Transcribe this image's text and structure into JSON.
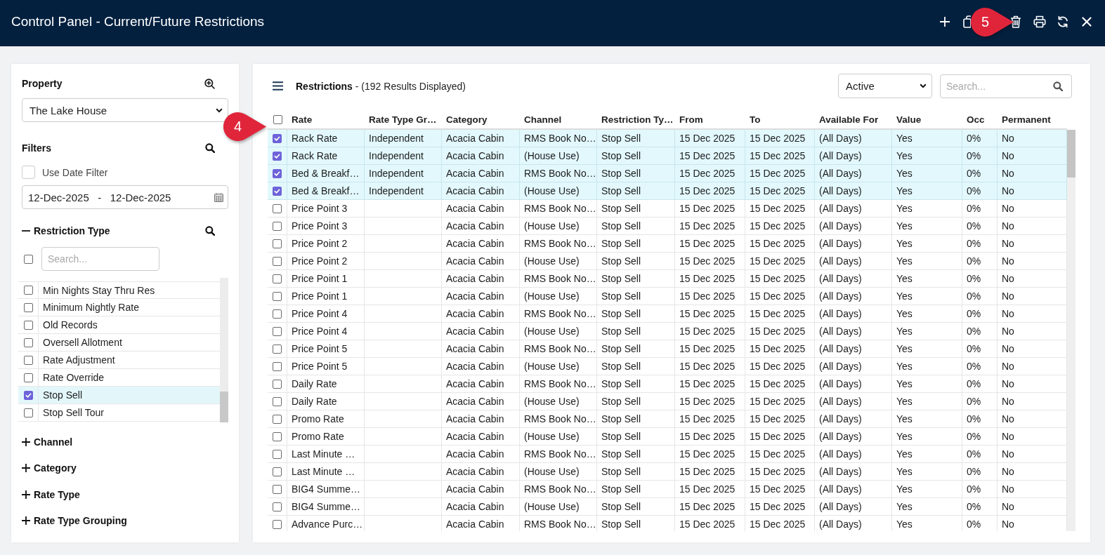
{
  "window": {
    "title": "Control Panel - Current/Future Restrictions"
  },
  "annotations": [
    {
      "number": "5"
    },
    {
      "number": "4"
    }
  ],
  "sidebar": {
    "property": {
      "label": "Property",
      "value": "The Lake House"
    },
    "filters": {
      "label": "Filters",
      "use_date_filter": {
        "label": "Use Date Filter",
        "checked": false
      },
      "date_range": "12-Dec-2025   -   12-Dec-2025"
    },
    "sections": [
      {
        "label": "Restriction Type",
        "expanded": true,
        "select_all_checked": false,
        "search": {
          "placeholder": "Search..."
        },
        "items": [
          {
            "label": "Min Nights Stay Thru Res",
            "checked": false
          },
          {
            "label": "Minimum Nightly Rate",
            "checked": false
          },
          {
            "label": "Old Records",
            "checked": false
          },
          {
            "label": "Oversell Allotment",
            "checked": false
          },
          {
            "label": "Rate Adjustment",
            "checked": false
          },
          {
            "label": "Rate Override",
            "checked": false
          },
          {
            "label": "Stop Sell",
            "checked": true
          },
          {
            "label": "Stop Sell Tour",
            "checked": false
          }
        ]
      },
      {
        "label": "Channel",
        "expanded": false
      },
      {
        "label": "Category",
        "expanded": false
      },
      {
        "label": "Rate Type",
        "expanded": false
      },
      {
        "label": "Rate Type Grouping",
        "expanded": false
      }
    ]
  },
  "results": {
    "heading": "**Restrictions** - (192 Results Displayed)",
    "status_filter": {
      "value": "Active"
    },
    "search": {
      "placeholder": "Search..."
    },
    "table": {
      "select_all_checked": false,
      "columns": [
        "Rate",
        "Rate Type Gr…",
        "Category",
        "Channel",
        "Restriction Ty…",
        "From",
        "To",
        "Available For",
        "Value",
        "Occ",
        "Permanent"
      ],
      "rows": [
        {
          "selected": true,
          "cells": [
            "Rack Rate",
            "Independent",
            "Acacia Cabin",
            "RMS Book No…",
            "Stop Sell",
            "15 Dec 2025",
            "15 Dec 2025",
            "(All Days)",
            "Yes",
            "0%",
            "No"
          ]
        },
        {
          "selected": true,
          "cells": [
            "Rack Rate",
            "Independent",
            "Acacia Cabin",
            "(House Use)",
            "Stop Sell",
            "15 Dec 2025",
            "15 Dec 2025",
            "(All Days)",
            "Yes",
            "0%",
            "No"
          ]
        },
        {
          "selected": true,
          "cells": [
            "Bed & Breakf…",
            "Independent",
            "Acacia Cabin",
            "RMS Book No…",
            "Stop Sell",
            "15 Dec 2025",
            "15 Dec 2025",
            "(All Days)",
            "Yes",
            "0%",
            "No"
          ]
        },
        {
          "selected": true,
          "cells": [
            "Bed & Breakf…",
            "Independent",
            "Acacia Cabin",
            "(House Use)",
            "Stop Sell",
            "15 Dec 2025",
            "15 Dec 2025",
            "(All Days)",
            "Yes",
            "0%",
            "No"
          ]
        },
        {
          "selected": false,
          "cells": [
            "Price Point 3",
            null,
            "Acacia Cabin",
            "RMS Book No…",
            "Stop Sell",
            "15 Dec 2025",
            "15 Dec 2025",
            "(All Days)",
            "Yes",
            "0%",
            "No"
          ]
        },
        {
          "selected": false,
          "cells": [
            "Price Point 3",
            null,
            "Acacia Cabin",
            "(House Use)",
            "Stop Sell",
            "15 Dec 2025",
            "15 Dec 2025",
            "(All Days)",
            "Yes",
            "0%",
            "No"
          ]
        },
        {
          "selected": false,
          "cells": [
            "Price Point 2",
            null,
            "Acacia Cabin",
            "RMS Book No…",
            "Stop Sell",
            "15 Dec 2025",
            "15 Dec 2025",
            "(All Days)",
            "Yes",
            "0%",
            "No"
          ]
        },
        {
          "selected": false,
          "cells": [
            "Price Point 2",
            null,
            "Acacia Cabin",
            "(House Use)",
            "Stop Sell",
            "15 Dec 2025",
            "15 Dec 2025",
            "(All Days)",
            "Yes",
            "0%",
            "No"
          ]
        },
        {
          "selected": false,
          "cells": [
            "Price Point 1",
            null,
            "Acacia Cabin",
            "RMS Book No…",
            "Stop Sell",
            "15 Dec 2025",
            "15 Dec 2025",
            "(All Days)",
            "Yes",
            "0%",
            "No"
          ]
        },
        {
          "selected": false,
          "cells": [
            "Price Point 1",
            null,
            "Acacia Cabin",
            "(House Use)",
            "Stop Sell",
            "15 Dec 2025",
            "15 Dec 2025",
            "(All Days)",
            "Yes",
            "0%",
            "No"
          ]
        },
        {
          "selected": false,
          "cells": [
            "Price Point 4",
            null,
            "Acacia Cabin",
            "RMS Book No…",
            "Stop Sell",
            "15 Dec 2025",
            "15 Dec 2025",
            "(All Days)",
            "Yes",
            "0%",
            "No"
          ]
        },
        {
          "selected": false,
          "cells": [
            "Price Point 4",
            null,
            "Acacia Cabin",
            "(House Use)",
            "Stop Sell",
            "15 Dec 2025",
            "15 Dec 2025",
            "(All Days)",
            "Yes",
            "0%",
            "No"
          ]
        },
        {
          "selected": false,
          "cells": [
            "Price Point 5",
            null,
            "Acacia Cabin",
            "RMS Book No…",
            "Stop Sell",
            "15 Dec 2025",
            "15 Dec 2025",
            "(All Days)",
            "Yes",
            "0%",
            "No"
          ]
        },
        {
          "selected": false,
          "cells": [
            "Price Point 5",
            null,
            "Acacia Cabin",
            "(House Use)",
            "Stop Sell",
            "15 Dec 2025",
            "15 Dec 2025",
            "(All Days)",
            "Yes",
            "0%",
            "No"
          ]
        },
        {
          "selected": false,
          "cells": [
            "Daily Rate",
            null,
            "Acacia Cabin",
            "RMS Book No…",
            "Stop Sell",
            "15 Dec 2025",
            "15 Dec 2025",
            "(All Days)",
            "Yes",
            "0%",
            "No"
          ]
        },
        {
          "selected": false,
          "cells": [
            "Daily Rate",
            null,
            "Acacia Cabin",
            "(House Use)",
            "Stop Sell",
            "15 Dec 2025",
            "15 Dec 2025",
            "(All Days)",
            "Yes",
            "0%",
            "No"
          ]
        },
        {
          "selected": false,
          "cells": [
            "Promo Rate",
            null,
            "Acacia Cabin",
            "RMS Book No…",
            "Stop Sell",
            "15 Dec 2025",
            "15 Dec 2025",
            "(All Days)",
            "Yes",
            "0%",
            "No"
          ]
        },
        {
          "selected": false,
          "cells": [
            "Promo Rate",
            null,
            "Acacia Cabin",
            "(House Use)",
            "Stop Sell",
            "15 Dec 2025",
            "15 Dec 2025",
            "(All Days)",
            "Yes",
            "0%",
            "No"
          ]
        },
        {
          "selected": false,
          "cells": [
            "Last Minute …",
            null,
            "Acacia Cabin",
            "RMS Book No…",
            "Stop Sell",
            "15 Dec 2025",
            "15 Dec 2025",
            "(All Days)",
            "Yes",
            "0%",
            "No"
          ]
        },
        {
          "selected": false,
          "cells": [
            "Last Minute …",
            null,
            "Acacia Cabin",
            "(House Use)",
            "Stop Sell",
            "15 Dec 2025",
            "15 Dec 2025",
            "(All Days)",
            "Yes",
            "0%",
            "No"
          ]
        },
        {
          "selected": false,
          "cells": [
            "BIG4 Summe…",
            null,
            "Acacia Cabin",
            "RMS Book No…",
            "Stop Sell",
            "15 Dec 2025",
            "15 Dec 2025",
            "(All Days)",
            "Yes",
            "0%",
            "No"
          ]
        },
        {
          "selected": false,
          "cells": [
            "BIG4 Summe…",
            null,
            "Acacia Cabin",
            "(House Use)",
            "Stop Sell",
            "15 Dec 2025",
            "15 Dec 2025",
            "(All Days)",
            "Yes",
            "0%",
            "No"
          ]
        },
        {
          "selected": false,
          "cells": [
            "Advance Purc…",
            null,
            "Acacia Cabin",
            "RMS Book No…",
            "Stop Sell",
            "15 Dec 2025",
            "15 Dec 2025",
            "(All Days)",
            "Yes",
            "0%",
            "No"
          ]
        }
      ]
    }
  }
}
